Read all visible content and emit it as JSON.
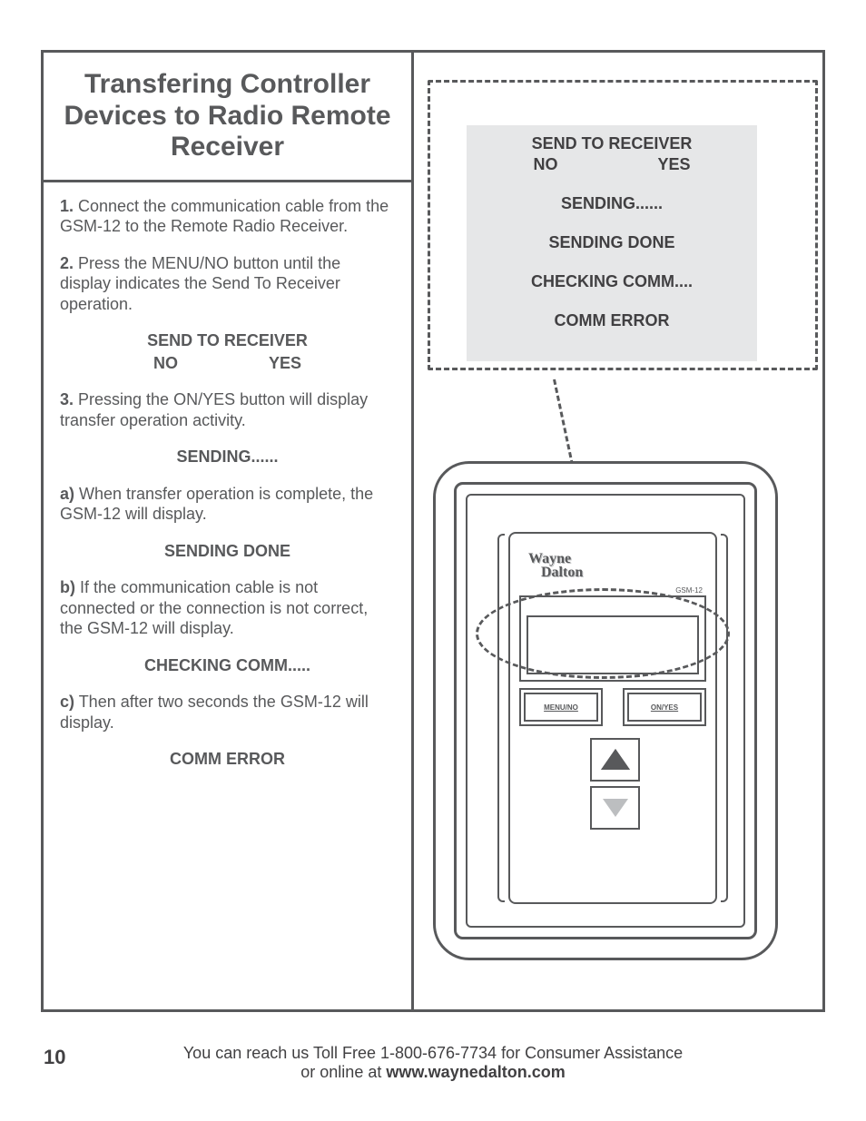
{
  "title": "Transfering Controller Devices to Radio Remote Receiver",
  "steps": {
    "s1": {
      "num": "1.",
      "text": " Connect the communication cable from the GSM-12 to the Remote Radio Receiver."
    },
    "s2": {
      "num": "2.",
      "text": " Press the MENU/NO button until the display indicates the Send To Receiver operation."
    },
    "s3": {
      "num": "3.",
      "text": " Pressing the ON/YES button will display transfer operation activity."
    },
    "sa": {
      "num": "a)",
      "text": " When transfer operation is complete, the GSM-12 will display."
    },
    "sb": {
      "num": "b)",
      "text": " If the communication cable is not connected or the connection is not correct, the GSM-12 will display."
    },
    "sc": {
      "num": "c)",
      "text": " Then after two seconds the GSM-12 will display."
    }
  },
  "display": {
    "send_title": "SEND TO RECEIVER",
    "no": "NO",
    "yes": "YES",
    "sending": "SENDING......",
    "sending_done": "SENDING DONE",
    "checking": "CHECKING COMM.....",
    "checking_r": "CHECKING COMM....",
    "comm_error": "COMM ERROR"
  },
  "device": {
    "brand1": "Wayne",
    "brand2": "Dalton",
    "model": "GSM-12",
    "btn_menu": "MENU/NO",
    "btn_on": "ON/YES"
  },
  "footer": {
    "line1": "You can reach us Toll Free 1-800-676-7734 for Consumer Assistance",
    "line2_a": "or online at ",
    "line2_b": "www.waynedalton.com"
  },
  "page_number": "10"
}
